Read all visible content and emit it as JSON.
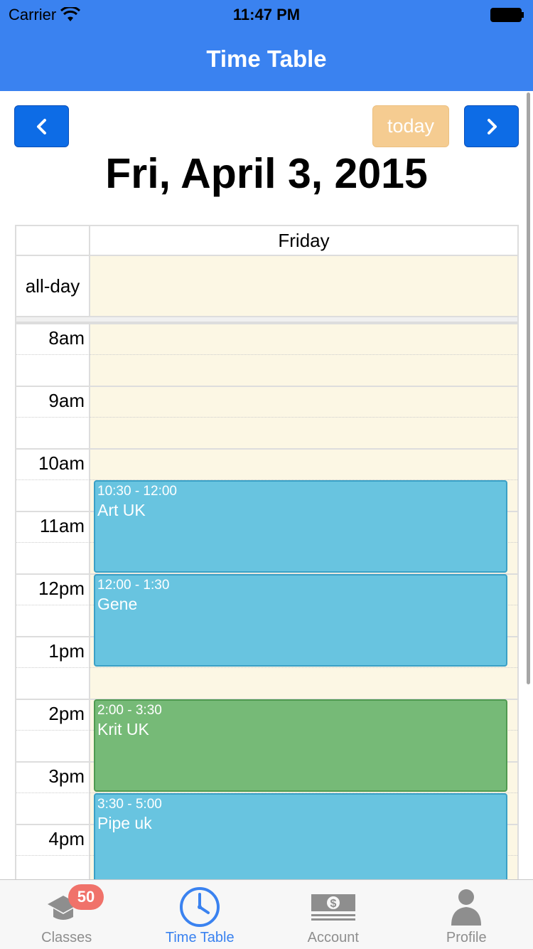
{
  "status": {
    "carrier": "Carrier",
    "time": "11:47 PM"
  },
  "nav": {
    "title": "Time Table"
  },
  "toolbar": {
    "today_label": "today",
    "date_title": "Fri, April 3, 2015"
  },
  "calendar": {
    "day_header": "Friday",
    "allday_label": "all-day",
    "hours": [
      "8am",
      "9am",
      "10am",
      "11am",
      "12pm",
      "1pm",
      "2pm",
      "3pm",
      "4pm"
    ],
    "events": [
      {
        "time": "10:30 - 12:00",
        "title": "Art UK",
        "color": "#68c4e0"
      },
      {
        "time": "12:00 - 1:30",
        "title": "Gene",
        "color": "#68c4e0"
      },
      {
        "time": "2:00 - 3:30",
        "title": "Krit UK",
        "color": "#76ba77"
      },
      {
        "time": "3:30 - 5:00",
        "title": "Pipe uk",
        "color": "#68c4e0"
      }
    ]
  },
  "tabs": [
    {
      "label": "Classes",
      "icon": "graduation-cap-icon",
      "badge": "50"
    },
    {
      "label": "Time Table",
      "icon": "clock-icon",
      "active": true
    },
    {
      "label": "Account",
      "icon": "money-icon"
    },
    {
      "label": "Profile",
      "icon": "person-icon"
    }
  ],
  "colors": {
    "nav_bar": "#3a82f0",
    "nav_button": "#0d6ce6",
    "today_button": "#f5cc91",
    "calendar_bg": "#fcf7e4",
    "badge": "#f0726a"
  }
}
